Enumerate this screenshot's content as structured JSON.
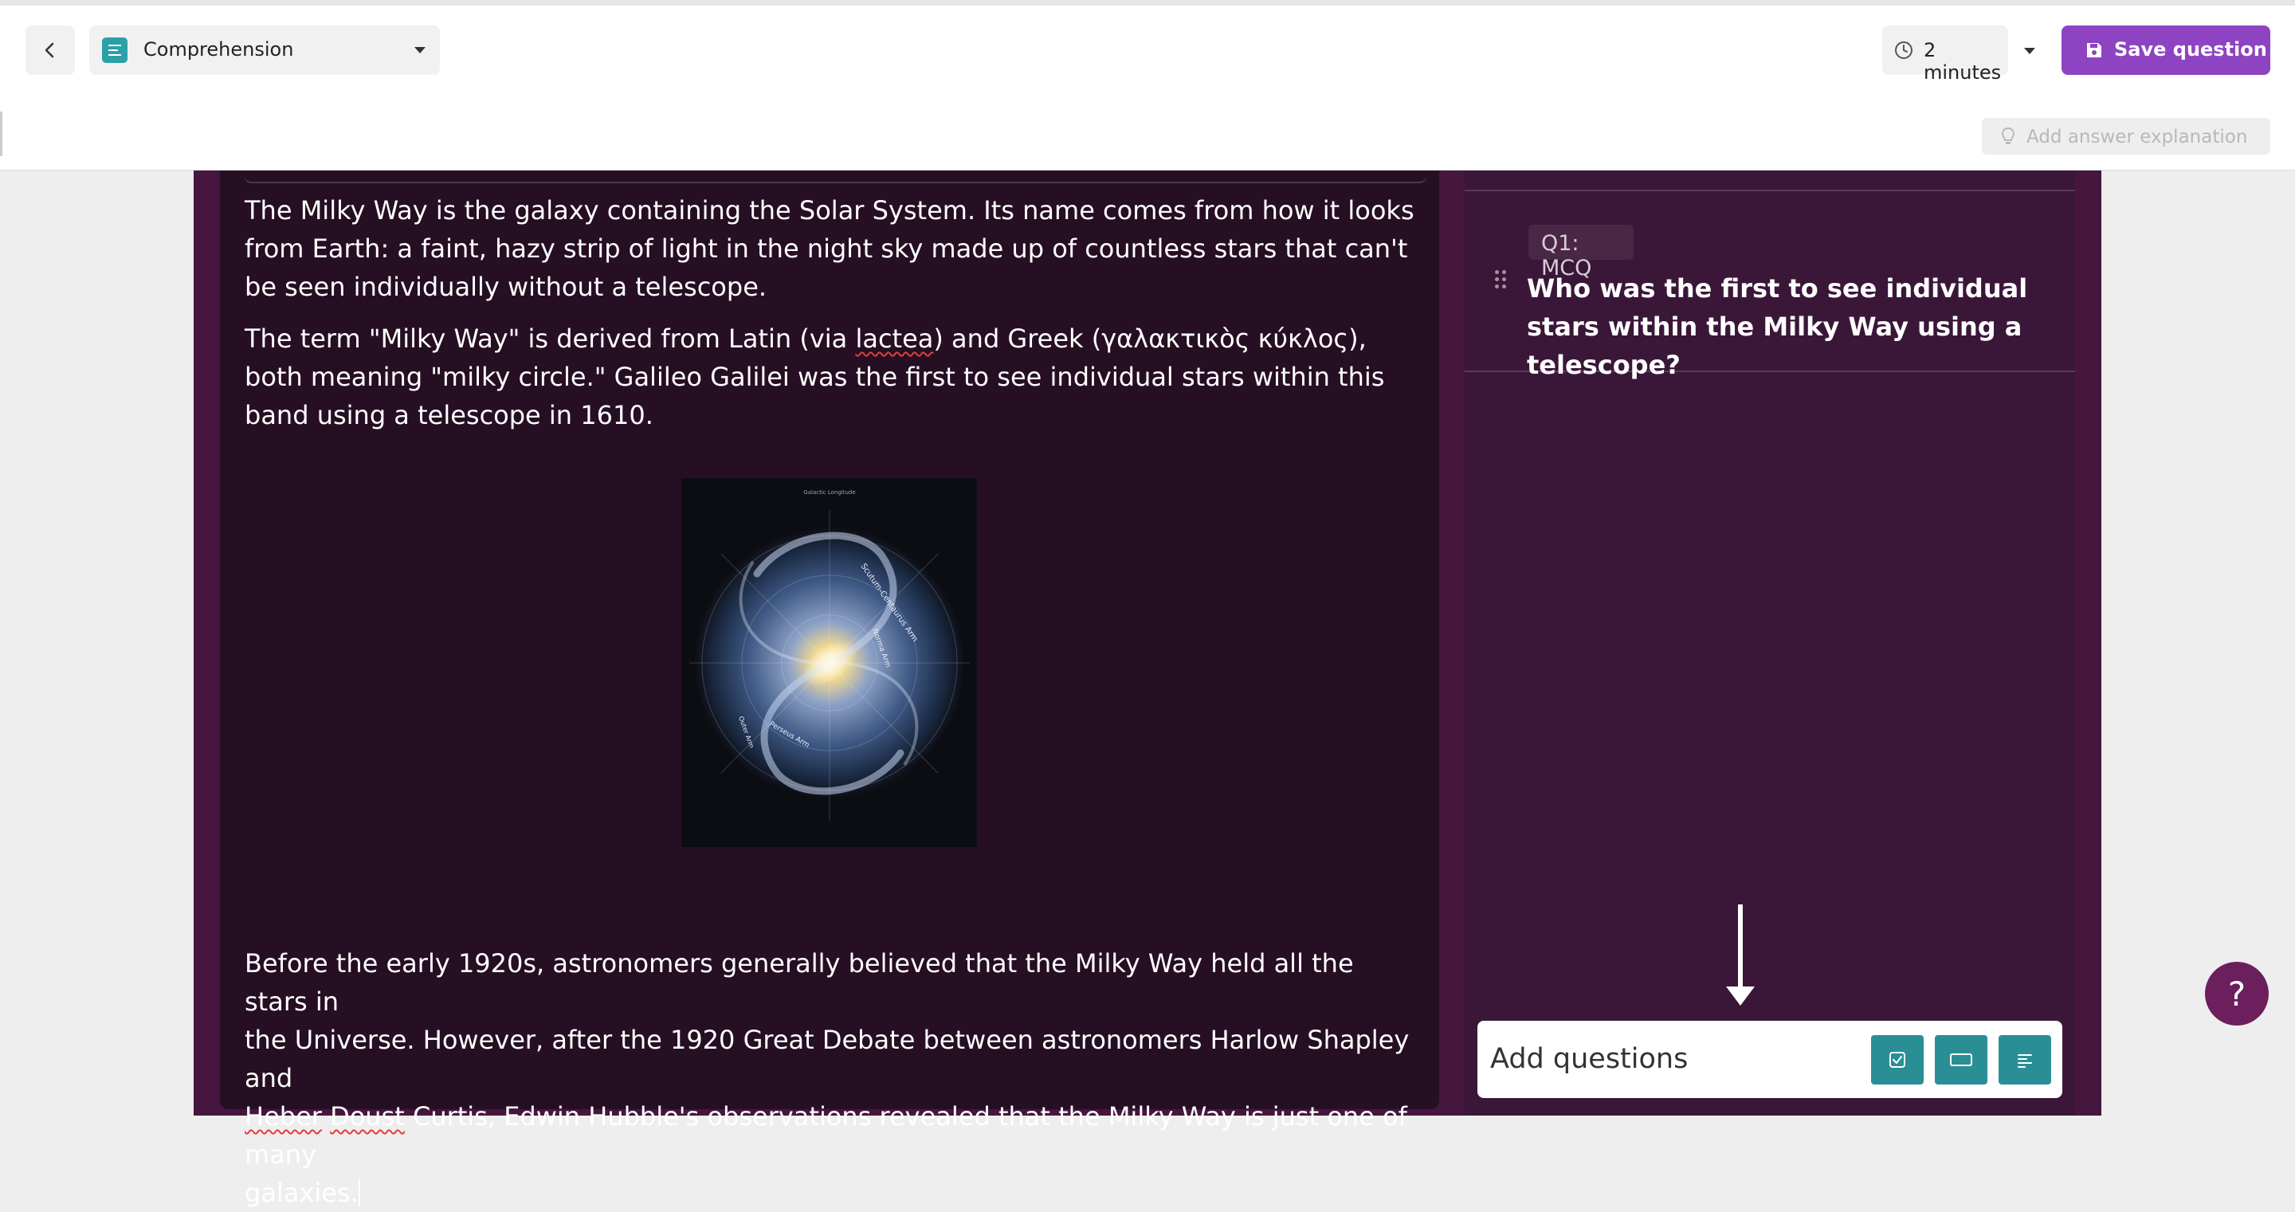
{
  "header": {
    "question_type": "Comprehension",
    "time_limit": "2 minutes",
    "save_label": "Save question",
    "explanation_label": "Add answer explanation"
  },
  "passage": {
    "paragraphs": [
      "The Milky Way is the galaxy containing the Solar System. Its name comes from how it looks from Earth: a faint, hazy strip of light in the night sky made up of countless stars that can't be seen individually without a telescope.",
      "Galileo Galilei was the first to see individual stars within this band using a telescope in 1610.",
      "the Universe. However, after the 1920 Great Debate between astronomers Harlow Shapley and",
      "Curtis, Edwin Hubble's observations revealed that the Milky Way is just one of many",
      "galaxies."
    ],
    "p2_pre": "The term \"Milky Way\" is derived from Latin (via ",
    "p2_latin": "lactea",
    "p2_post": ") and Greek (γαλακτικὸς κύκλος), both meaning \"milky circle.\" ",
    "p3_line1": "Before the early 1920s, astronomers generally believed that the Milky Way held all the stars in",
    "p3_name1": "Heber",
    "p3_name2": "Doust",
    "image": {
      "label_top": "Galactic Longitude",
      "arm_labels": [
        "Scutum-Centaurus Arm",
        "Norma Arm",
        "Perseus Arm",
        "Outer Arm"
      ]
    }
  },
  "questions": {
    "items": [
      {
        "badge": "Q1: MCQ",
        "text": "Who was the first to see individual stars within the Milky Way using a telescope?"
      }
    ],
    "add_label": "Add questions",
    "add_types": [
      "multiple-choice-icon",
      "blank-icon",
      "open-ended-icon"
    ]
  },
  "help": {
    "label": "?"
  },
  "colors": {
    "accent_purple": "#8e44c2",
    "teal": "#2a8f95",
    "passage_bg": "#260f22",
    "panel_bg": "#3a1738",
    "frame_bg": "#46163f"
  }
}
